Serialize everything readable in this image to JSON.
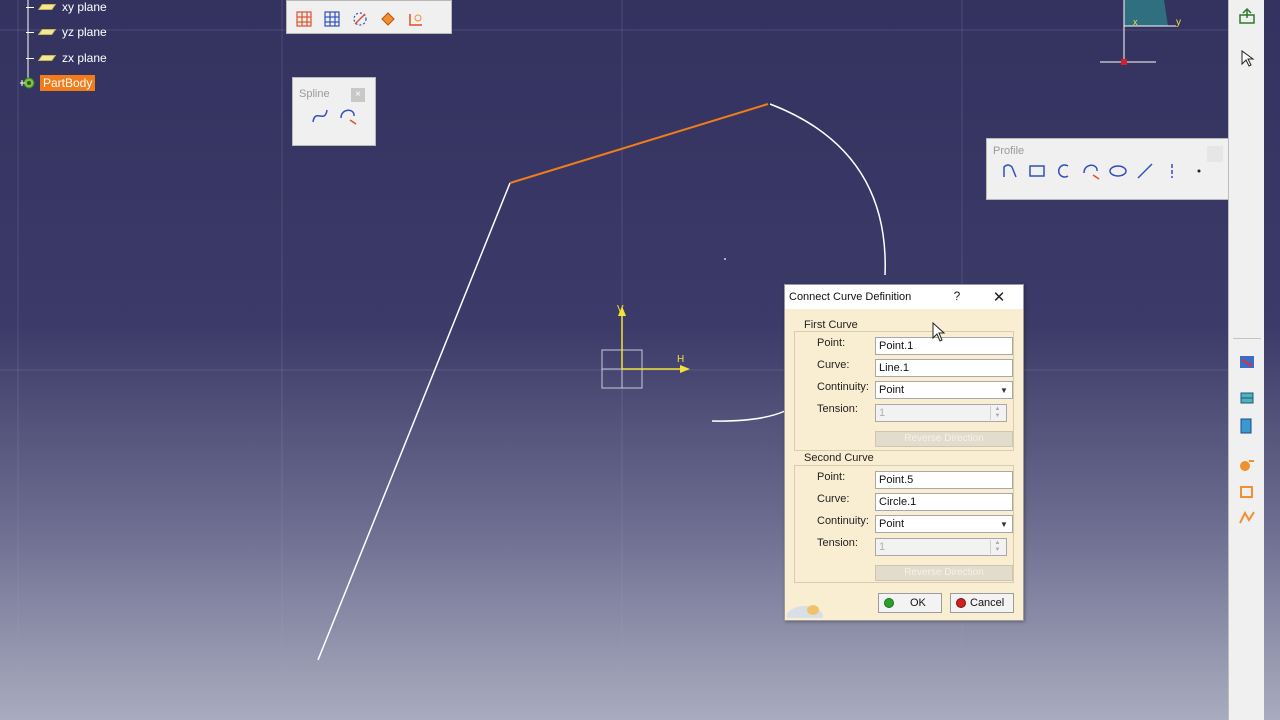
{
  "spec_tree": {
    "items": [
      {
        "label": "xy plane"
      },
      {
        "label": "yz plane"
      },
      {
        "label": "zx plane"
      }
    ],
    "part_body": "PartBody"
  },
  "spline_toolbar": {
    "title": "Spline",
    "close": "×"
  },
  "profile_toolbar": {
    "title": "Profile"
  },
  "canvas": {
    "axis_v_label": "V",
    "axis_h_label": "H",
    "compass_x_label": "x",
    "compass_y_label": "y"
  },
  "dialog": {
    "title": "Connect Curve Definition",
    "help": "?",
    "close": "✕",
    "first_curve": {
      "title": "First Curve",
      "point_label": "Point:",
      "point_value": "Point.1",
      "curve_label": "Curve:",
      "curve_value": "Line.1",
      "continuity_label": "Continuity:",
      "continuity_value": "Point",
      "tension_label": "Tension:",
      "tension_value": "1",
      "reverse_label": "Reverse Direction"
    },
    "second_curve": {
      "title": "Second Curve",
      "point_label": "Point:",
      "point_value": "Point.5",
      "curve_label": "Curve:",
      "curve_value": "Circle.1",
      "continuity_label": "Continuity:",
      "continuity_value": "Point",
      "tension_label": "Tension:",
      "tension_value": "1",
      "reverse_label": "Reverse Direction"
    },
    "ok_label": "OK",
    "cancel_label": "Cancel"
  },
  "colors": {
    "selection_orange": "#f07c1c",
    "axis_yellow": "#f2e23a",
    "geometry_white": "#ffffff"
  },
  "icons": {
    "plane": "plane-icon",
    "gear": "gear-icon",
    "ok": "green-dot-icon",
    "cancel": "red-dot-icon"
  }
}
